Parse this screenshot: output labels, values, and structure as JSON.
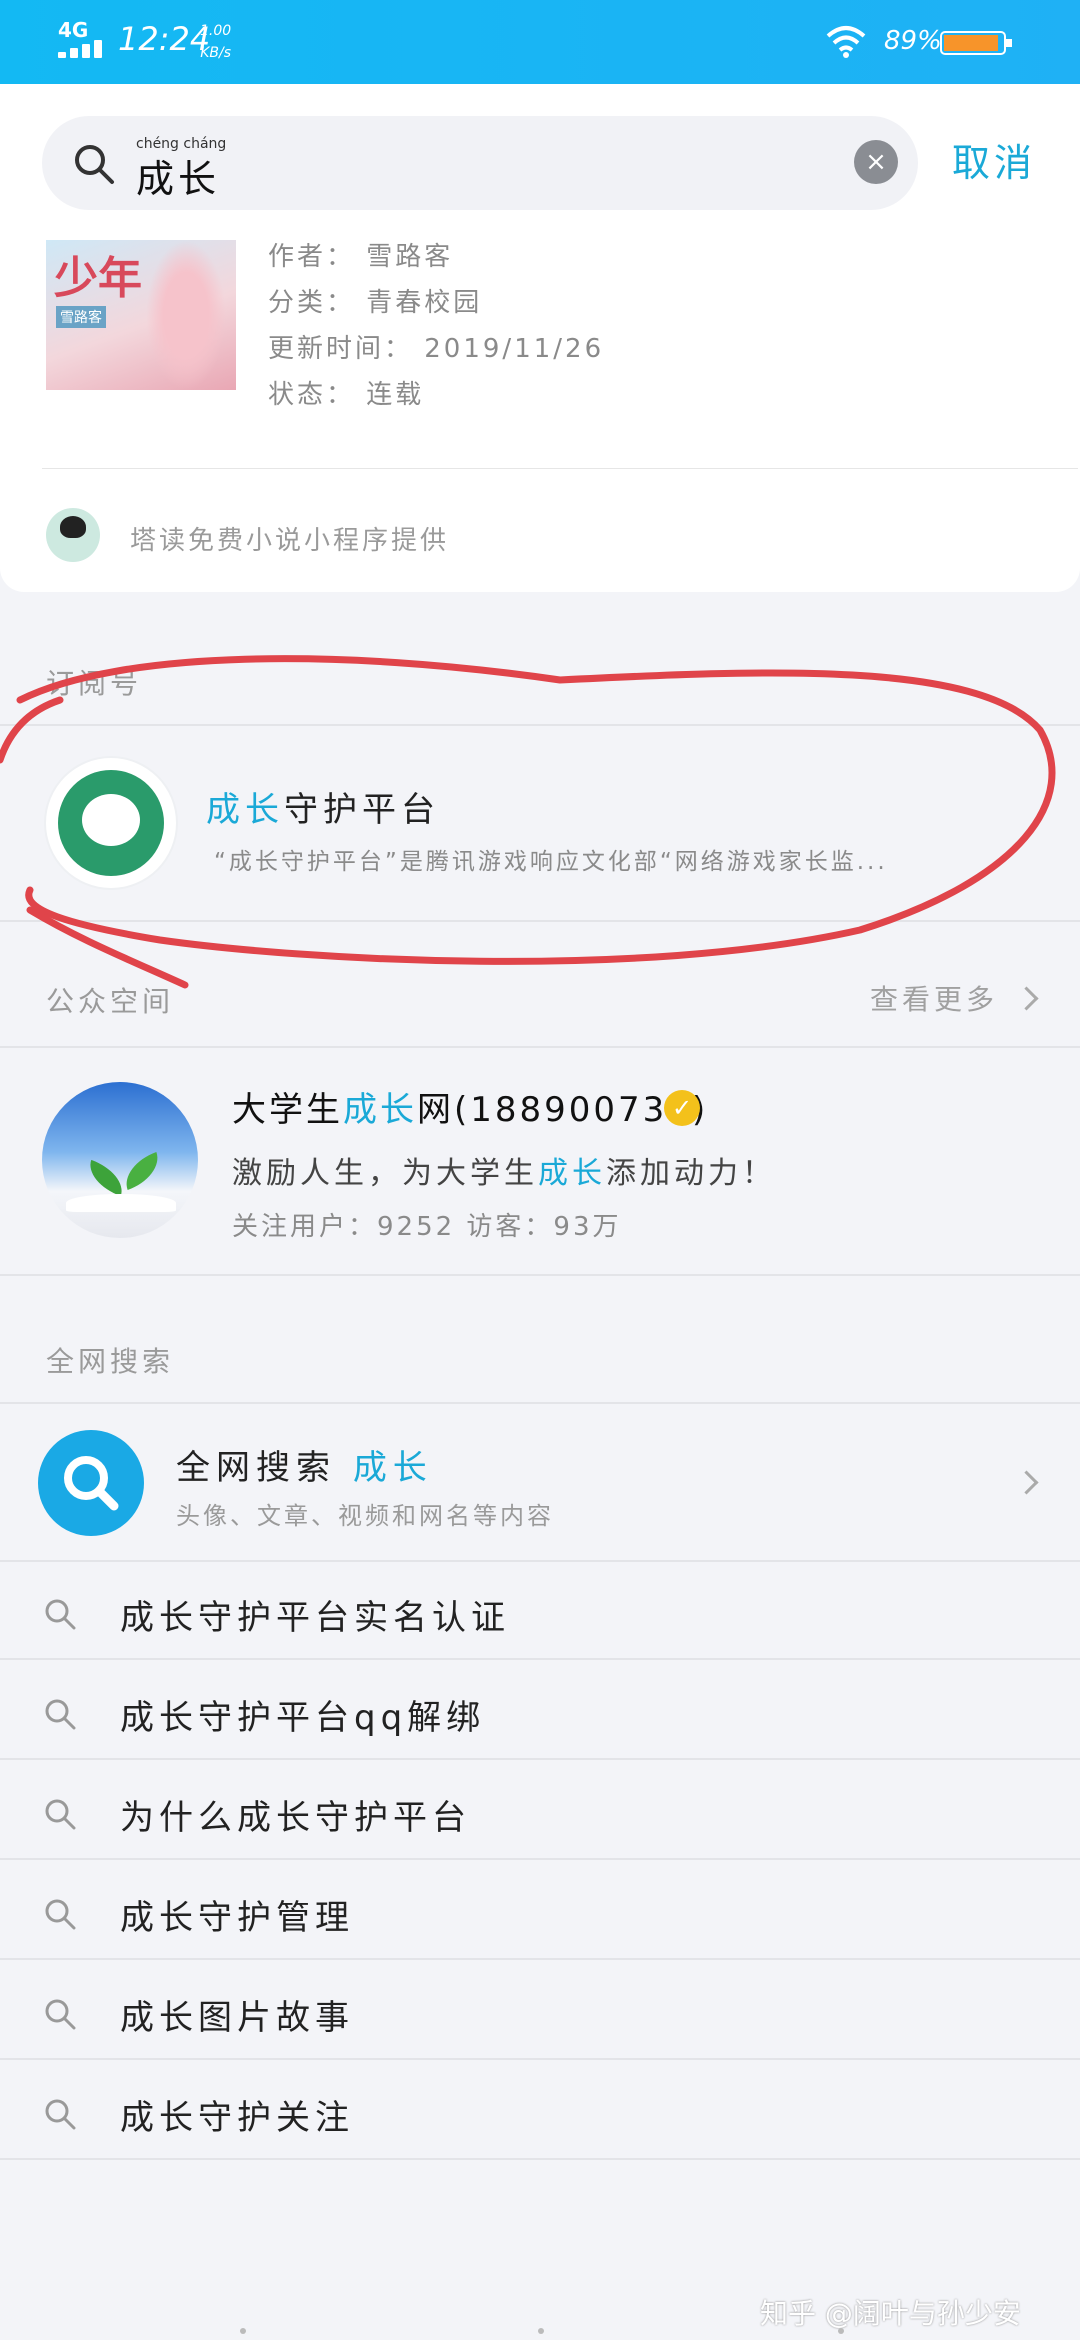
{
  "status_bar": {
    "network": "4G",
    "time": "12:24",
    "speed_value": "1.00",
    "speed_unit": "KB/s",
    "battery": "89%"
  },
  "search": {
    "query": "成长",
    "query_pinyin": "chéng cháng",
    "cancel_label": "取消"
  },
  "book": {
    "cover_title": "少年",
    "cover_author": "雪路客",
    "author_line": "作者：  雪路客",
    "category_line": "分类：  青春校园",
    "updated_line": "更新时间：  2019/11/26",
    "status_line": "状态：  连载",
    "provider": "塔读免费小说小程序提供"
  },
  "subscription": {
    "section_title": "订阅号",
    "name_highlight": "成长",
    "name_rest": "守护平台",
    "description": "“成长守护平台”是腾讯游戏响应文化部“网络游戏家长监..."
  },
  "public_space": {
    "section_title": "公众空间",
    "more_label": "查看更多",
    "name_pre": "大学生",
    "name_highlight": "成长",
    "name_post": "网(188900730)",
    "desc_pre": "激励人生，为大学生",
    "desc_highlight": "成长",
    "desc_post": "添加动力！",
    "stats": "关注用户：9252  访客：93万"
  },
  "web_search": {
    "section_title": "全网搜索",
    "title": "全网搜索",
    "title_highlight": "成长",
    "subtitle": "头像、文章、视频和网名等内容"
  },
  "suggestions": [
    "成长守护平台实名认证",
    "成长守护平台qq解绑",
    "为什么成长守护平台",
    "成长守护管理",
    "成长图片故事",
    "成长守护关注"
  ],
  "watermark": "知乎 @阔叶与孙少安",
  "colors": {
    "accent": "#1aa9d7",
    "status_bar": "#1bb5f4",
    "annotation": "#e0444a",
    "verify": "#f3c11b"
  }
}
